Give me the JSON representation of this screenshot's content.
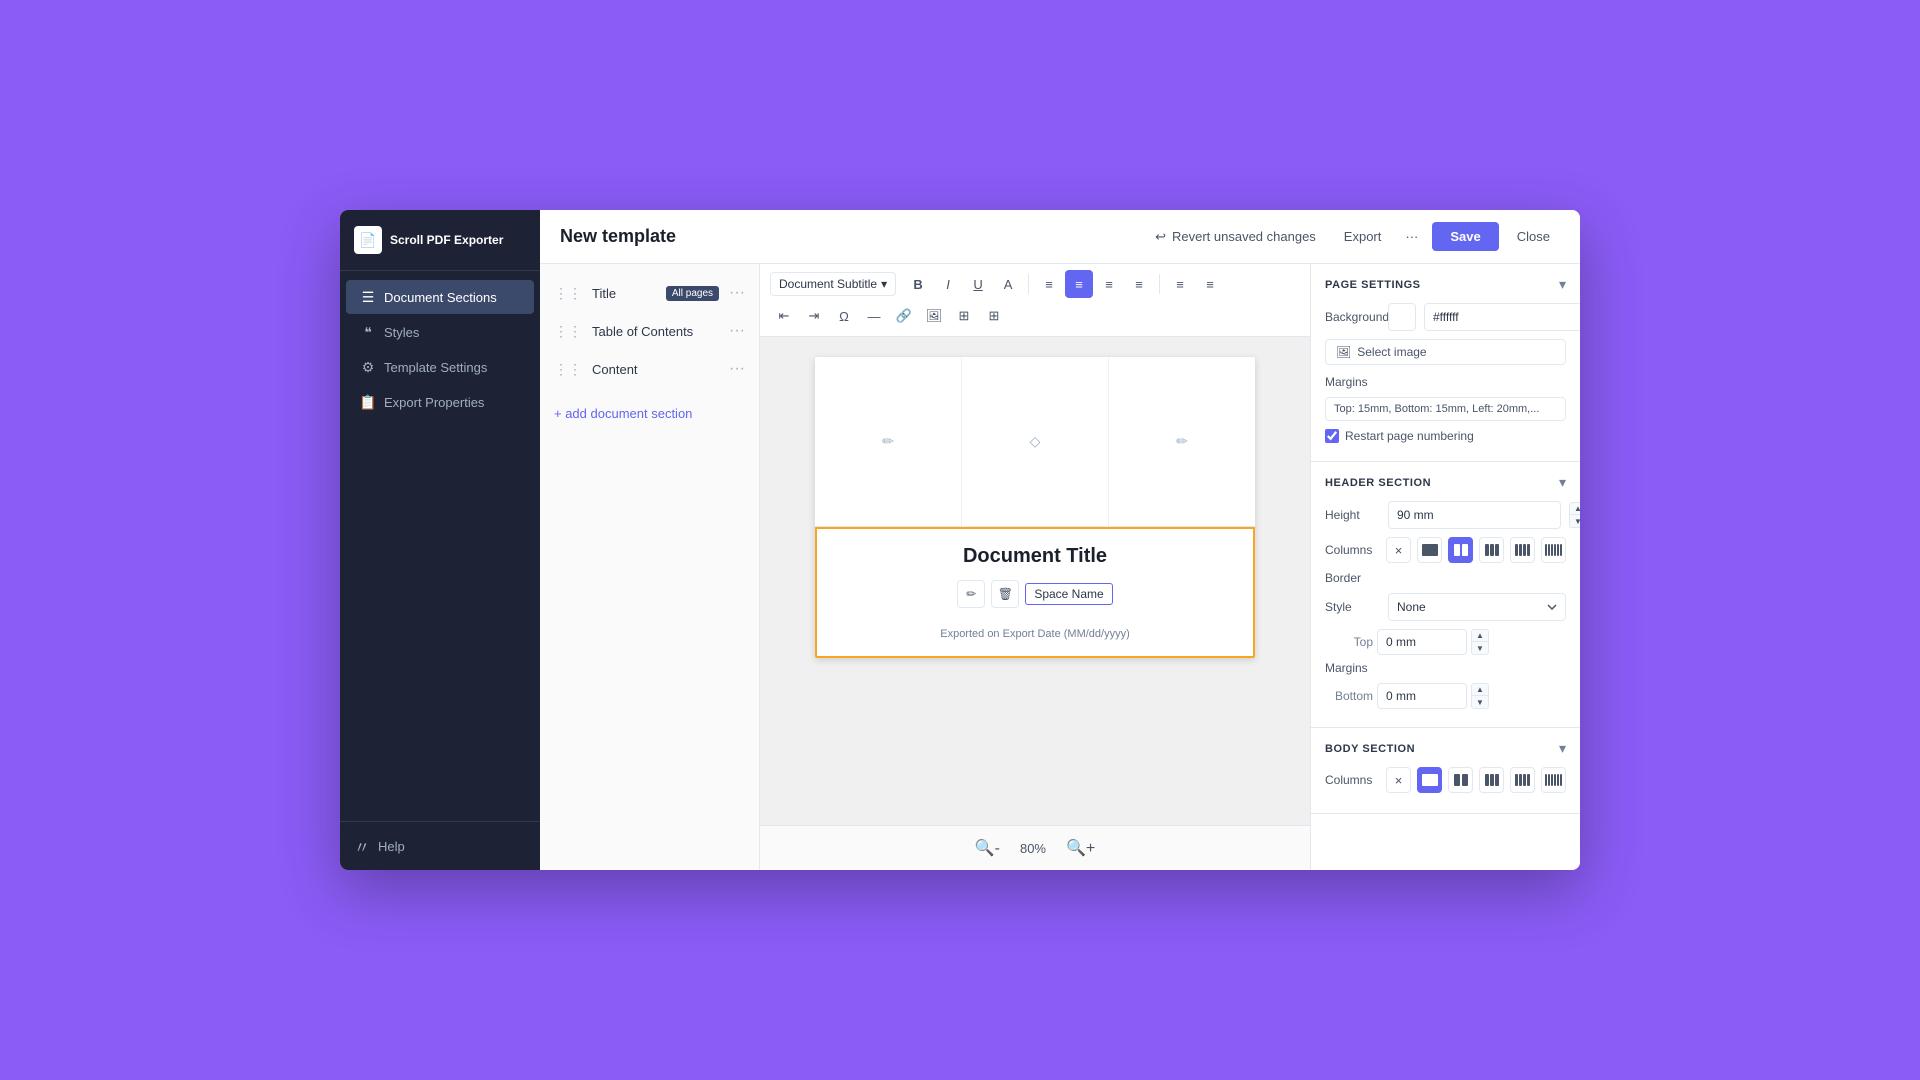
{
  "app": {
    "name": "Scroll PDF Exporter"
  },
  "header": {
    "title": "New template",
    "revert_label": "Revert unsaved changes",
    "export_label": "Export",
    "more_label": "···",
    "save_label": "Save",
    "close_label": "Close"
  },
  "sidebar": {
    "items": [
      {
        "id": "document-sections",
        "label": "Document Sections",
        "icon": "☰",
        "active": true
      },
      {
        "id": "styles",
        "label": "Styles",
        "icon": "❝",
        "active": false
      },
      {
        "id": "template-settings",
        "label": "Template Settings",
        "icon": "⚙",
        "active": false
      },
      {
        "id": "export-properties",
        "label": "Export Properties",
        "icon": "📄",
        "active": false
      }
    ],
    "help_label": "Help"
  },
  "sections": {
    "items": [
      {
        "name": "Title",
        "badge": "All pages"
      },
      {
        "name": "Table of Contents",
        "badge": null
      },
      {
        "name": "Content",
        "badge": null
      }
    ],
    "add_label": "+ add document section"
  },
  "toolbar": {
    "style_selector": "Document Subtitle",
    "buttons": [
      "B",
      "I",
      "U",
      "A",
      "≡",
      "≡",
      "≡",
      "≡",
      "≡",
      "≡"
    ],
    "row2_buttons": [
      "⊤",
      "⊥",
      "Ω",
      "—",
      "🔗",
      "🖼",
      "+",
      "⊞"
    ]
  },
  "canvas": {
    "zoom": "80%",
    "document_title": "Document Title",
    "space_name_label": "Space Name",
    "exported_line": "Exported on  Export Date (MM/dd/yyyy)"
  },
  "right_panel": {
    "page_settings_title": "PAGE SETTINGS",
    "background_label": "Background",
    "background_color": "#ffffff",
    "background_hex": "#ffffff",
    "select_image_label": "Select image",
    "margins_label": "Margins",
    "margins_value": "Top: 15mm, Bottom: 15mm, Left: 20mm,...",
    "restart_numbering_label": "Restart page numbering",
    "header_section_title": "HEADER SECTION",
    "height_label": "Height",
    "height_value": "90 mm",
    "columns_label": "Columns",
    "border_label": "Border",
    "border_style_label": "Style",
    "border_style_value": "None",
    "top_label": "Top",
    "top_value": "0 mm",
    "margins_bottom_label": "Bottom",
    "bottom_value": "0 mm",
    "body_section_title": "BODY SECTION",
    "body_columns_label": "Columns"
  }
}
